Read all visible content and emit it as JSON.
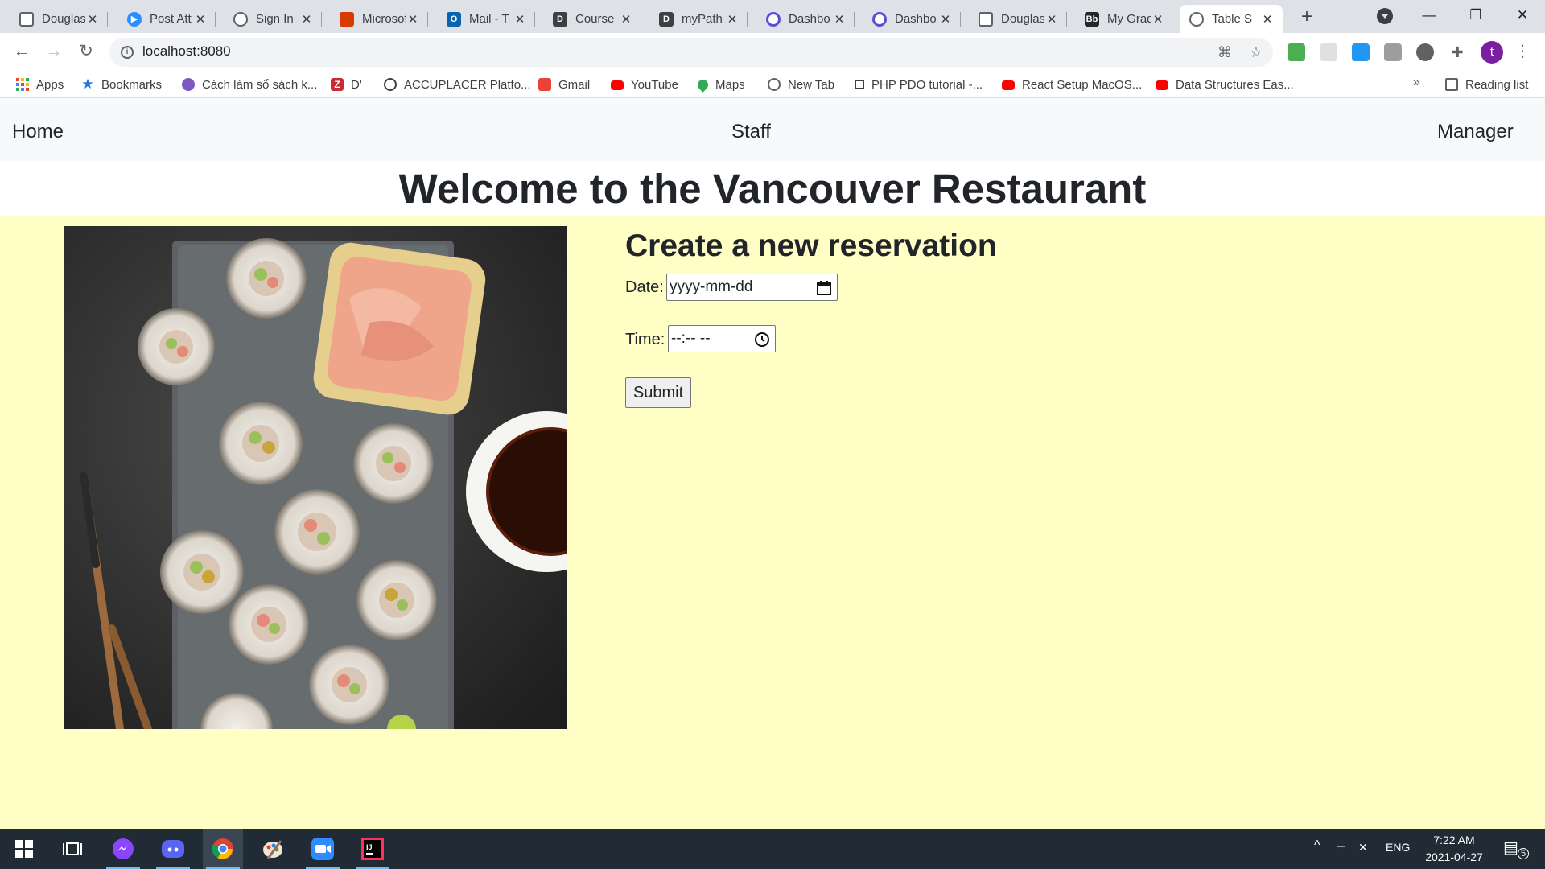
{
  "browser": {
    "tabs": [
      {
        "label": "Douglas",
        "icon": "douglas-icon",
        "color": "#5f6368"
      },
      {
        "label": "Post Att",
        "icon": "zoom-icon",
        "color": "#2d8cff"
      },
      {
        "label": "Sign In",
        "icon": "globe-icon",
        "color": "#5f6368"
      },
      {
        "label": "Microsoft",
        "icon": "office-icon",
        "color": "#d83b01"
      },
      {
        "label": "Mail - T",
        "icon": "outlook-icon",
        "color": "#0a64ad"
      },
      {
        "label": "Course",
        "icon": "d2l-icon",
        "color": "#3c4043"
      },
      {
        "label": "myPath",
        "icon": "d2l-icon",
        "color": "#3c4043"
      },
      {
        "label": "Dashbo",
        "icon": "dashboard-icon",
        "color": "#5b4cdb"
      },
      {
        "label": "Dashbo",
        "icon": "dashboard-icon",
        "color": "#5b4cdb"
      },
      {
        "label": "Douglas",
        "icon": "douglas-icon",
        "color": "#5f6368"
      },
      {
        "label": "My Grad",
        "icon": "blackboard-icon",
        "color": "#262626"
      },
      {
        "label": "Table S",
        "icon": "globe-icon",
        "color": "#5f6368"
      }
    ],
    "url": "localhost:8080",
    "bookmarks": [
      {
        "label": "Apps",
        "icon": "apps-grid-icon"
      },
      {
        "label": "Bookmarks",
        "icon": "star-icon",
        "color": "#1a73e8"
      },
      {
        "label": "Cách làm sổ sách k...",
        "icon": "bookmark-site-icon",
        "color": "#7e57c2"
      },
      {
        "label": "D'",
        "icon": "zotero-icon",
        "color": "#cc2936"
      },
      {
        "label": "ACCUPLACER Platfo...",
        "icon": "accuplacer-icon",
        "color": "#3c4043"
      },
      {
        "label": "Gmail",
        "icon": "gmail-icon",
        "color": "#ea4335"
      },
      {
        "label": "YouTube",
        "icon": "youtube-icon",
        "color": "#ff0000"
      },
      {
        "label": "Maps",
        "icon": "maps-icon",
        "color": "#34a853"
      },
      {
        "label": "New Tab",
        "icon": "globe-icon",
        "color": "#5f6368"
      },
      {
        "label": "PHP PDO tutorial -...",
        "icon": "page-icon",
        "color": "#3c4043"
      },
      {
        "label": "React Setup MacOS...",
        "icon": "youtube-icon",
        "color": "#ff0000"
      },
      {
        "label": "Data Structures Eas...",
        "icon": "youtube-icon",
        "color": "#ff0000"
      }
    ],
    "more_bookmarks": "»",
    "reading_list": "Reading list",
    "profile_initial": "t"
  },
  "nav": {
    "home": "Home",
    "staff": "Staff",
    "manager": "Manager"
  },
  "page": {
    "title": "Welcome to the Vancouver Restaurant",
    "form_heading": "Create a new reservation",
    "date_label": "Date:",
    "date_placeholder": "yyyy-mm-dd",
    "time_label": "Time:",
    "time_placeholder": "--:-- --",
    "submit_label": "Submit",
    "band_color": "#ffffc5",
    "photo_subject": "sushi-rolls-photo"
  },
  "taskbar": {
    "apps": [
      "windows-start-icon",
      "task-view-icon",
      "messenger-icon",
      "discord-icon",
      "chrome-icon",
      "paint-icon",
      "zoom-icon",
      "intellij-icon"
    ],
    "language": "ENG",
    "time": "7:22 AM",
    "date": "2021-04-27",
    "notification_count": "5"
  }
}
